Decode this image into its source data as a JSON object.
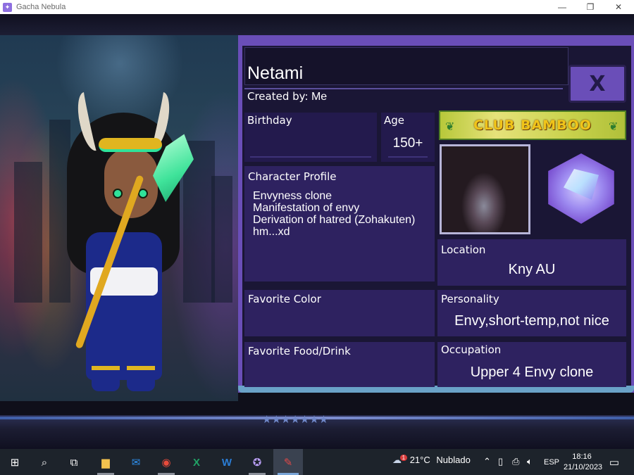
{
  "window": {
    "title": "Gacha Nebula",
    "minimize_glyph": "—",
    "maximize_glyph": "❐",
    "close_glyph": "✕"
  },
  "decor": {
    "stars": "★★★★★★★"
  },
  "profile": {
    "name": "Netami",
    "created_by_label": "Created by:",
    "created_by_value": "Me",
    "close_label": "X",
    "birthday": {
      "label": "Birthday",
      "value": ""
    },
    "age": {
      "label": "Age",
      "value": "150+"
    },
    "character_profile": {
      "label": "Character Profile",
      "lines": [
        "Envyness clone",
        "Manifestation of envy",
        "Derivation of hatred (Zohakuten)",
        "hm...xd"
      ]
    },
    "club_banner": "CLUB BAMBOO",
    "location": {
      "label": "Location",
      "value": "Kny AU"
    },
    "favorite_color": {
      "label": "Favorite Color",
      "value": ""
    },
    "personality": {
      "label": "Personality",
      "value": "Envy,short-temp,not nice"
    },
    "favorite_food": {
      "label": "Favorite Food/Drink",
      "value": ""
    },
    "occupation": {
      "label": "Occupation",
      "value": "Upper 4 Envy clone"
    }
  },
  "taskbar": {
    "weather_temp": "21°C",
    "weather_desc": "Nublado",
    "weather_badge": "1",
    "language": "ESP",
    "time": "18:16",
    "date": "21/10/2023"
  },
  "colors": {
    "panel_purple": "#6a4eb8",
    "panel_dark": "#1a1635",
    "field_purple": "#2e2260",
    "accent_green": "#2fe39a"
  }
}
